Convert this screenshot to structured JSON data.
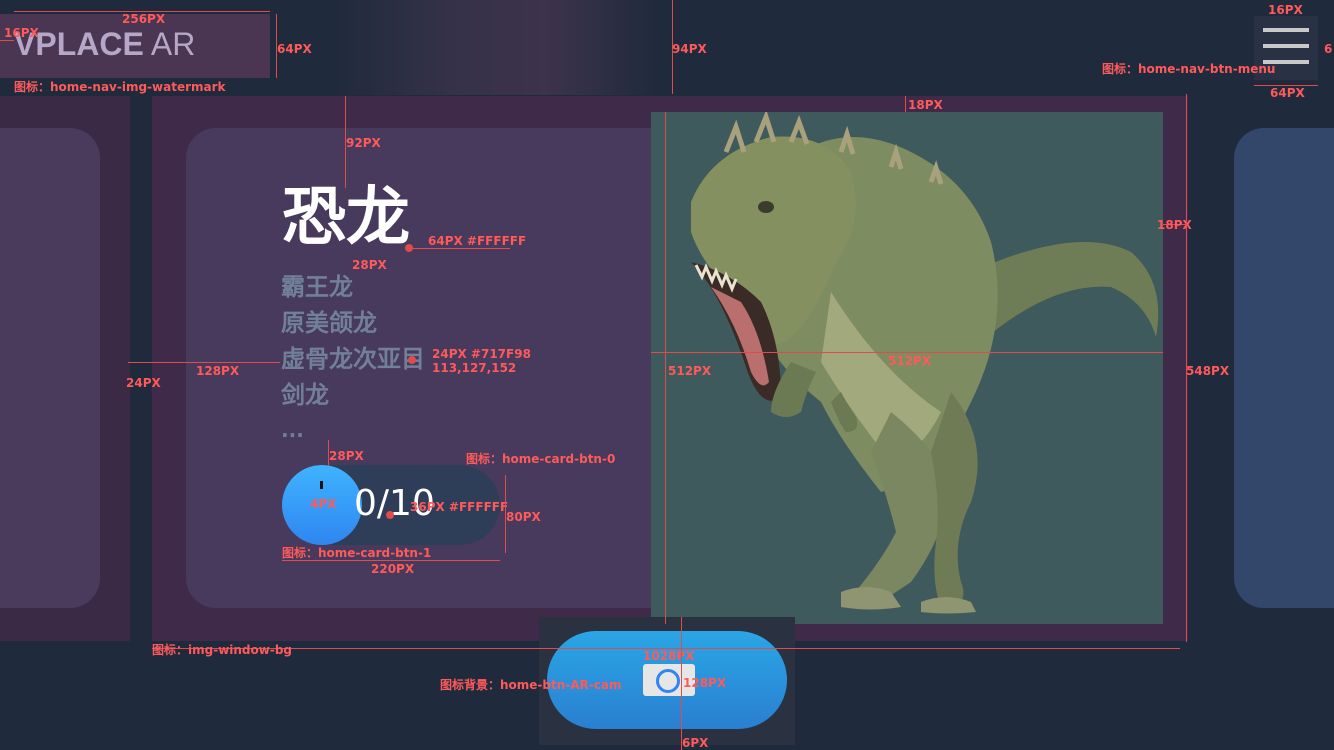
{
  "watermark": {
    "brand_bold": "VPLACE",
    "brand_light": " AR"
  },
  "card": {
    "title": "恐龙",
    "items": [
      "霸王龙",
      "原美颌龙",
      "虚骨龙次亚目",
      "剑龙",
      "..."
    ],
    "counter": "0/10"
  },
  "colors": {
    "title": "#FFFFFF",
    "list": "#717F98",
    "counter": "#FFFFFF",
    "accent": "#2F86F0"
  },
  "icons": [
    "menu-icon",
    "camera-icon",
    "dinosaur-photo"
  ],
  "annotations": {
    "a16px_left": "16PX",
    "a256px": "256PX",
    "a64px_wm": "64PX",
    "wm_label": "图标：home-nav-img-watermark",
    "a94px": "94PX",
    "a16px_menu": "16PX",
    "a6px_menu": "6",
    "menu_label": "图标：home-nav-btn-menu",
    "a64px_menu": "64PX",
    "a18px_top": "18PX",
    "a92px": "92PX",
    "title_spec": "64PX #FFFFFF",
    "a28px_1": "28PX",
    "a18px_right": "18PX",
    "list_spec": "24PX #717F98",
    "list_rgb": "113,127,152",
    "a24px": "24PX",
    "a128px": "128PX",
    "a512px_v": "512PX",
    "a512px_h": "512PX",
    "a548px": "548PX",
    "a28px_2": "28PX",
    "btn0_label": "图标：home-card-btn-0",
    "a4px": "4PX",
    "counter_spec": "36PX #FFFFFF",
    "a80px": "80PX",
    "btn1_label": "图标：home-card-btn-1",
    "a220px": "220PX",
    "window_label": "图标：img-window-bg",
    "a1028px": "1028PX",
    "a128px_cam": "128PX",
    "cam_label": "图标背景：home-btn-AR-cam",
    "a6px_bottom": "6PX"
  }
}
